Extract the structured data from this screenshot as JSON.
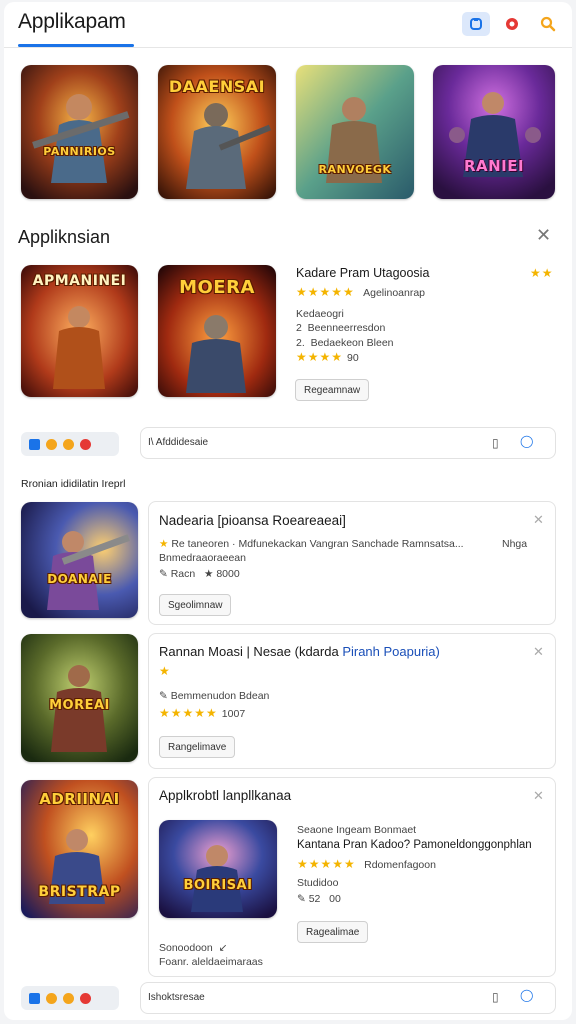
{
  "header": {
    "title": "Applikapam",
    "icons": [
      "app-icon",
      "record-icon",
      "search-icon"
    ],
    "accent": "#1a73e8"
  },
  "top_row": {
    "items": [
      {
        "art_text": "PANNIRIOS",
        "icon": "game-art"
      },
      {
        "art_text": "DAAENSAI",
        "icon": "game-art"
      },
      {
        "art_text": "RANVOEGK",
        "icon": "game-art"
      },
      {
        "art_text": "RANIEI",
        "icon": "game-art"
      }
    ]
  },
  "section1": {
    "title": "Appliknsian",
    "thumb1_text": "APMANINEI",
    "thumb2_text": "MOERA",
    "detail": {
      "title": "Kadare Pram Utagoosia",
      "rating_text": "Agelinoanrap",
      "line1": "Kedaeogri",
      "line2": "2  Beenneerresdon",
      "line3": "2.  Bedaekeon Bleen",
      "rating_value": "90",
      "button": "Regeamnaw"
    }
  },
  "bar1": {
    "label": "I\\ Afddidesaie"
  },
  "list_heading": "Rronian ididilatin Ireprl",
  "cards": [
    {
      "art_text": "DOANAIE",
      "title": "Nadearia [pioansa Roeareaeai]",
      "line1": "Re taneoren · Mdfunekackan Vangran Sanchade Ramnsatsa...",
      "line1b": "Nhga",
      "line2": "Bnmedraaoraeean",
      "line3a": "Racn",
      "line3b": "8000",
      "button": "Sgeolimnaw"
    },
    {
      "art_text": "MOREAI",
      "title": "Rannan Moasi | Nesae (kdarda ",
      "title_link": "Piranh Poapuria)",
      "line1": "Bemmenudon Bdean",
      "rating_value": "1007",
      "button": "Rangelimave"
    },
    {
      "art_text": "BRISTRAP",
      "art_top": "ADRIINAI",
      "title": "Applkrobtl lanpllkanaa",
      "inner_art": "BOIRISAI",
      "info1": "Seaone Ingeam Bonmaet",
      "info2": "Kantana Pran Kadoo? Pamoneldonggonphlan",
      "rating_text": "Rdomenfagoon",
      "info3": "Studidoo",
      "info4a": "52",
      "info4b": "00",
      "button": "Ragealimae",
      "foot1": "Sonoodoon",
      "foot2": "Foanr. aleldaeimaraas"
    }
  ],
  "bar2": {
    "label": "Ishoktsresae"
  },
  "colors": {
    "star": "#f4b400",
    "link": "#1a4fb8",
    "dot_orange": "#f4a51c",
    "dot_red": "#e53935"
  }
}
